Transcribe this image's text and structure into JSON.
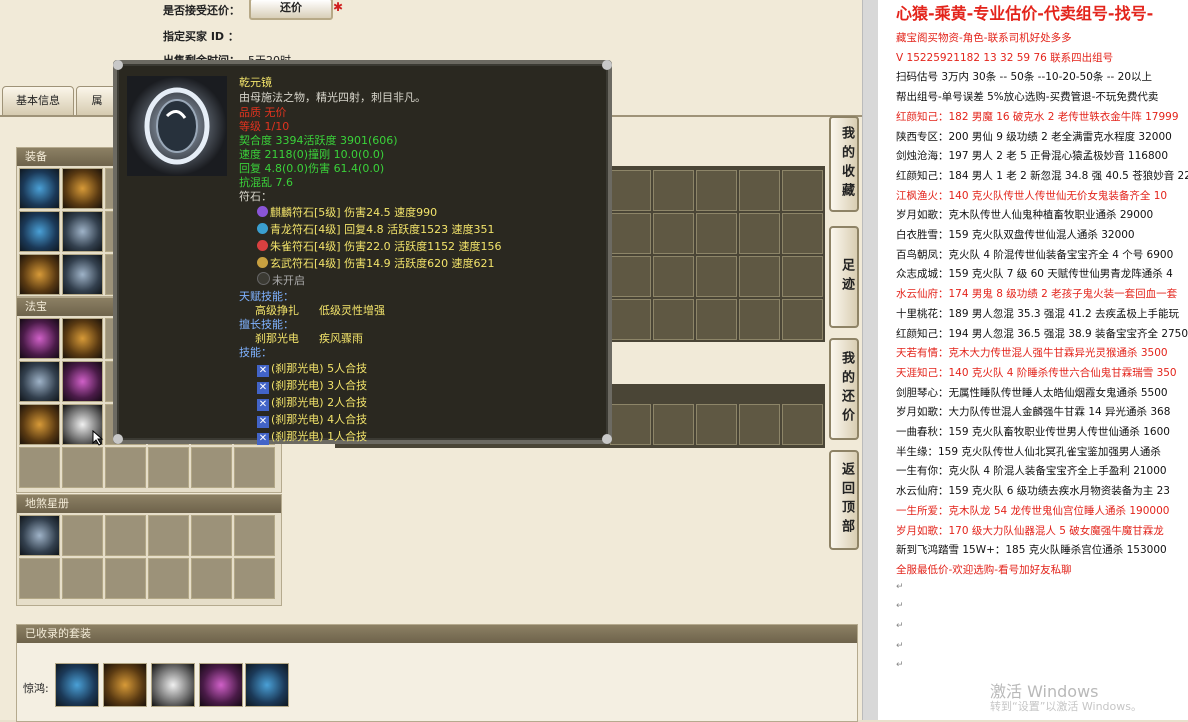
{
  "top": {
    "accept_counter_label": "是否接受还价：",
    "counter_button": "还价",
    "buyer_id_label": "指定买家 ID ：",
    "sale_time_label": "出售剩余时间：",
    "sale_time_value": "5天20时"
  },
  "tabs": [
    "基本信息",
    "属"
  ],
  "sections": {
    "equipment": "装备",
    "treasure": "法宝",
    "star_map": "地煞星册",
    "suits": "已收录的套装",
    "suit_row_label": "惊鸿:"
  },
  "side_tabs": [
    "我的收藏",
    "足迹",
    "我的还价",
    "返回顶部"
  ],
  "tooltip": {
    "name": "乾元镜",
    "desc": "由母施法之物，精光四射，刺目非凡。",
    "quality": "品质  无价",
    "level": "等级  1/10",
    "stats": [
      "契合度    3394活跃度  3901(606)",
      "速度      2118(0)撞刚    10.0(0.0)",
      "回复      4.8(0.0)伤害     61.4(0.0)"
    ],
    "resist": "抗混乱 7.6",
    "runes_label": "符石：",
    "runes": [
      {
        "text": "麒麟符石[5级] 伤害24.5 速度990",
        "color": "#8a55d8"
      },
      {
        "text": "青龙符石[4级] 回复4.8 活跃度1523 速度351",
        "color": "#3a9fd0"
      },
      {
        "text": "朱雀符石[4级] 伤害22.0 活跃度1152 速度156",
        "color": "#d84040"
      },
      {
        "text": "玄武符石[4级] 伤害14.9 活跃度620 速度621",
        "color": "#c8a040"
      }
    ],
    "unopened": "未开启",
    "talent_label": "天赋技能：",
    "talents": [
      "高级挣扎",
      "低级灵性增强"
    ],
    "specialty_label": "擅长技能：",
    "specialties": [
      "刹那光电",
      "疾风骤雨"
    ],
    "skills_label": "技能：",
    "skills": [
      "(刹那光电) 5人合技",
      "(刹那光电) 3人合技",
      "(刹那光电) 2人合技",
      "(刹那光电) 4人合技",
      "(刹那光电) 1人合技"
    ]
  },
  "doc": {
    "title": "心猿-乘黄-专业估价-代卖组号-找号-",
    "lines": [
      {
        "t": "藏宝阁买物资-角色-联系司机好处多多",
        "red": true
      },
      {
        "t": "V 15225921182  13 32 59 76 联系四出组号",
        "red": true
      },
      {
        "t": "扫码估号 3万内 30条 -- 50条 --10-20-50条 -- 20以上",
        "red": false
      },
      {
        "t": "帮出组号-单号误差 5%放心选购-买费管退-不玩免费代卖",
        "red": false
      },
      {
        "t": "红颜知己：182 男魔 16 破克水 2 老传世轶衣金牛阵 17999",
        "red": true
      },
      {
        "t": "陕西专区：200 男仙 9 级功绩 2 老全满雷克水程度 32000",
        "red": false
      },
      {
        "t": "剑烛沧海：197 男人 2 老 5 正骨混心猿孟极妙音 116800",
        "red": false
      },
      {
        "t": "红颜知己：184 男人 1 老 2 新忽混 34.8 强 40.5 苍狼妙音 22",
        "red": false
      },
      {
        "t": "江枫渔火：140 克火队传世人传世仙无价女鬼装备齐全 10",
        "red": true
      },
      {
        "t": "岁月如歌：克木队传世人仙鬼种植畜牧职业通杀 29000",
        "red": false
      },
      {
        "t": "白衣胜雪：159 克火队双盘传世仙混人通杀 32000",
        "red": false
      },
      {
        "t": "百鸟朝凤：克火队 4 阶混传世仙装备宝宝齐全 4 个号 6900",
        "red": false
      },
      {
        "t": "众志成城：159 克火队 7 级 60 天赋传世仙男青龙阵通杀 4",
        "red": false
      },
      {
        "t": "水云仙府：174 男鬼 8 级功绩 2 老孩子鬼火装一套回血一套",
        "red": true
      },
      {
        "t": "十里桃花：189 男人忽混 35.3 强混 41.2 去疾孟极上手能玩",
        "red": false
      },
      {
        "t": "红颜知己：194 男人忽混 36.5 强混 38.9 装备宝宝齐全 2750",
        "red": false
      },
      {
        "t": "天若有情：克木大力传世混人强牛甘霖异光灵猴通杀 3500",
        "red": true
      },
      {
        "t": "天涯知己：140 克火队 4 阶睡杀传世六合仙鬼甘霖瑞雪 350",
        "red": true
      },
      {
        "t": "剑胆琴心：无属性睡队传世睡人太皓仙烟霞女鬼通杀 5500",
        "red": false
      },
      {
        "t": "岁月如歌：大力队传世混人金麟强牛甘霖 14 异光通杀 368",
        "red": false
      },
      {
        "t": "一曲春秋：159 克火队畜牧职业传世男人传世仙通杀 1600",
        "red": false
      },
      {
        "t": "半生缘：159 克火队传世人仙北冥孔雀宝鉴加强男人通杀",
        "red": false
      },
      {
        "t": "一生有你：克火队 4 阶混人装备宝宝齐全上手盈利 21000",
        "red": false
      },
      {
        "t": "水云仙府：159 克火队 6 级功绩去疾水月物资装备为主 23",
        "red": false
      },
      {
        "t": "一生所爱：克木队龙 54 龙传世鬼仙宫位睡人通杀 190000 ",
        "red": true
      },
      {
        "t": "岁月如歌：170 级大力队仙器混人 5 破女魔强牛魔甘霖龙",
        "red": true
      },
      {
        "t": "新到飞鸿踏雪 15W+：185 克火队睡杀宫位通杀 153000",
        "red": false
      },
      {
        "t": "全服最低价-欢迎选购-看号加好友私聊",
        "red": true
      }
    ],
    "watermark": "激活 Windows",
    "watermark_sub": "转到“设置”以激活 Windows。"
  }
}
